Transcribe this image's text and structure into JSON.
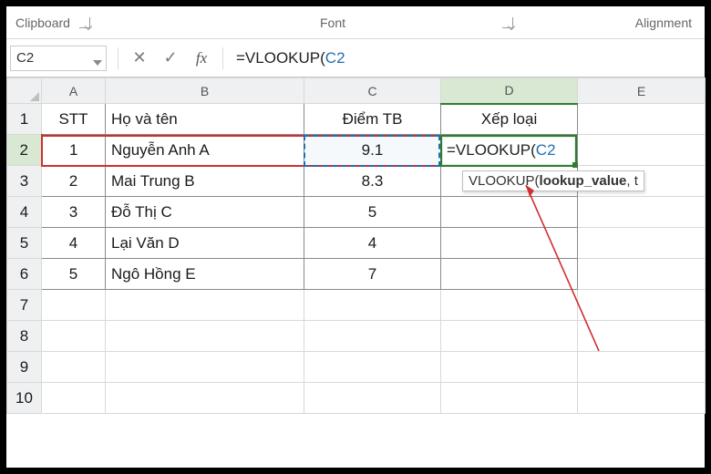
{
  "ribbon": {
    "clipboard": "Clipboard",
    "font": "Font",
    "alignment": "Alignment"
  },
  "formulaBar": {
    "nameBox": "C2",
    "cancel_glyph": "✕",
    "confirm_glyph": "✓",
    "fx_label": "fx",
    "formula_prefix": "=VLOOKUP(",
    "formula_ref": "C2"
  },
  "columns": [
    "A",
    "B",
    "C",
    "D",
    "E"
  ],
  "rowHeaders": [
    "1",
    "2",
    "3",
    "4",
    "5",
    "6",
    "7",
    "8",
    "9",
    "10"
  ],
  "headers": {
    "A": "STT",
    "B": "Họ và tên",
    "C": "Điểm TB",
    "D": "Xếp loại"
  },
  "rows": [
    {
      "stt": "1",
      "name": "Nguyễn Anh A",
      "score": "9.1"
    },
    {
      "stt": "2",
      "name": "Mai Trung B",
      "score": "8.3"
    },
    {
      "stt": "3",
      "name": "Đỗ Thị C",
      "score": "5"
    },
    {
      "stt": "4",
      "name": "Lại Văn D",
      "score": "4"
    },
    {
      "stt": "5",
      "name": "Ngô Hồng E",
      "score": "7"
    }
  ],
  "activeCell": {
    "formula_prefix": "=VLOOKUP(",
    "formula_ref": "C2"
  },
  "tooltip": {
    "fn": "VLOOKUP(",
    "bold_arg": "lookup_value",
    "tail": ", t"
  },
  "chart_data": {
    "type": "table",
    "title": "",
    "columns": [
      "STT",
      "Họ và tên",
      "Điểm TB",
      "Xếp loại"
    ],
    "rows": [
      [
        "1",
        "Nguyễn Anh A",
        9.1,
        ""
      ],
      [
        "2",
        "Mai Trung B",
        8.3,
        ""
      ],
      [
        "3",
        "Đỗ Thị C",
        5,
        ""
      ],
      [
        "4",
        "Lại Văn D",
        4,
        ""
      ],
      [
        "5",
        "Ngô Hồng E",
        7,
        ""
      ]
    ]
  }
}
